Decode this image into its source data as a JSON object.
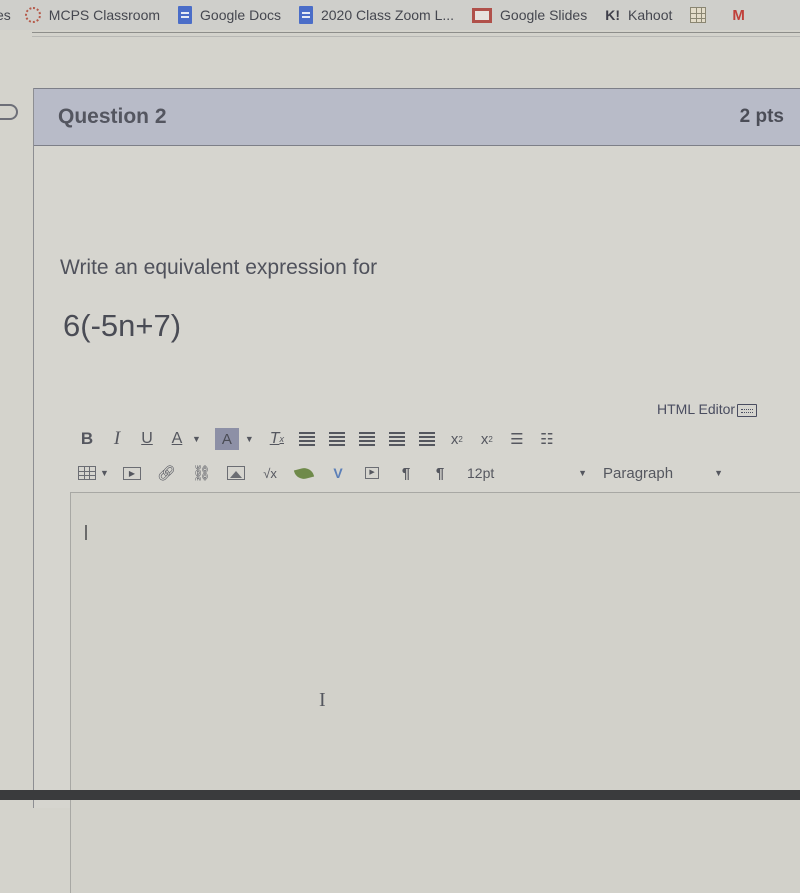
{
  "bookmarks": [
    {
      "label": "es",
      "icon": "truncated"
    },
    {
      "label": "MCPS Classroom",
      "icon": "mcps-icon"
    },
    {
      "label": "Google Docs",
      "icon": "google-docs-icon"
    },
    {
      "label": "2020 Class Zoom L...",
      "icon": "google-docs-icon"
    },
    {
      "label": "Google Slides",
      "icon": "google-slides-icon"
    },
    {
      "label": "Kahoot",
      "icon": "kahoot-icon",
      "glyph": "K!"
    },
    {
      "label": "",
      "icon": "grid-icon"
    },
    {
      "label": "",
      "icon": "gmail-icon",
      "glyph": "M"
    }
  ],
  "question": {
    "title": "Question 2",
    "points": "2 pts",
    "prompt": "Write an equivalent expression for",
    "expression": "6(-5n+7)"
  },
  "editor": {
    "html_editor_label": "HTML Editor",
    "toolbar_row1": {
      "bold": "B",
      "italic": "I",
      "underline": "U",
      "font_color": "A",
      "bg_color": "A",
      "clear_format": "T",
      "superscript": "x",
      "subscript": "x"
    },
    "toolbar_row2": {
      "font_size": "12pt",
      "block_format": "Paragraph",
      "media": "▶",
      "sqrt": "√x",
      "ltr": "¶",
      "rtl": "¶"
    },
    "content": ""
  },
  "colors": {
    "header_bg": "#b8bbc8",
    "leaf_green": "#6f8a4a",
    "accent_blue": "#5b7fb8"
  }
}
